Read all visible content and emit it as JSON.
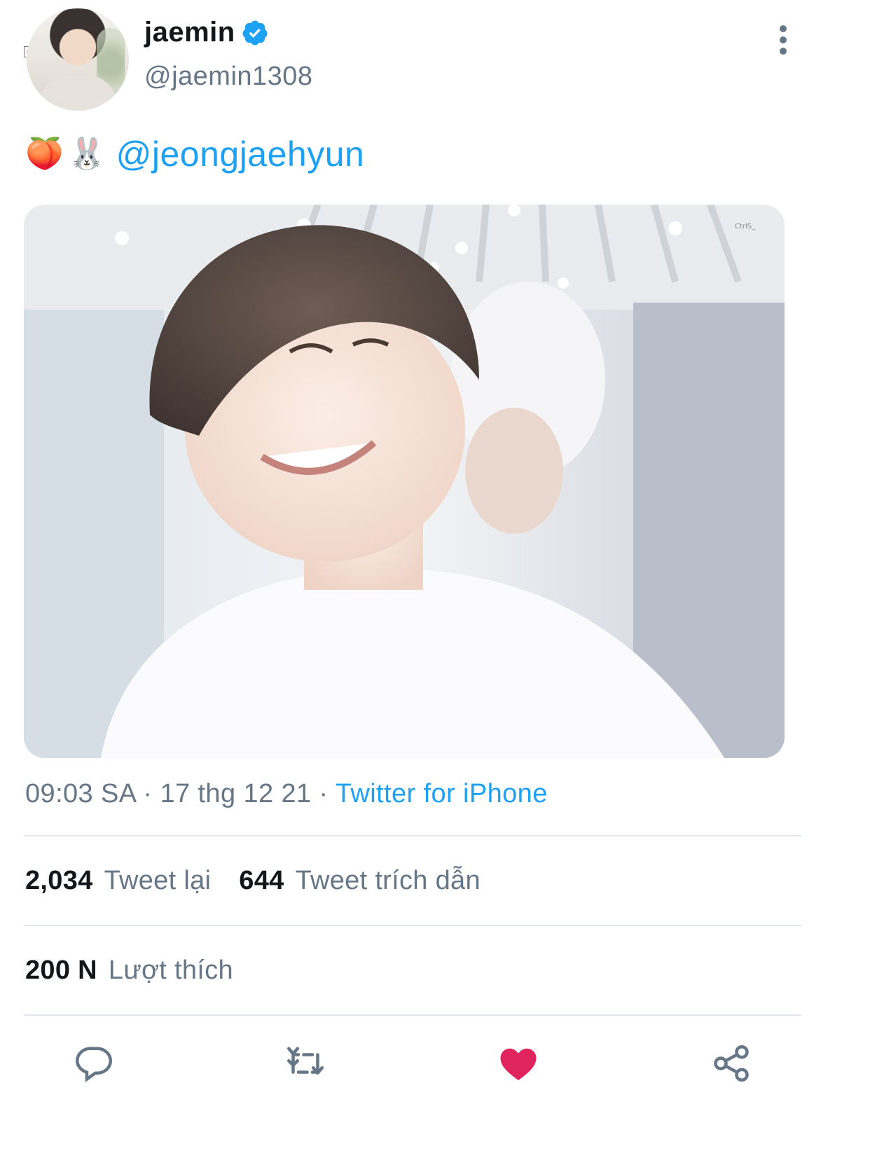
{
  "user": {
    "display_name": "jaemin",
    "handle": "@jaemin1308",
    "verified": true
  },
  "tweet": {
    "emojis": [
      "🍑",
      "🐰"
    ],
    "mention": "@jeongjaehyun",
    "watermark": "CtrlS_"
  },
  "meta": {
    "time": "09:03 SA",
    "separator": " · ",
    "date": "17 thg 12 21",
    "source": "Twitter for iPhone"
  },
  "stats": {
    "retweets": {
      "value": "2,034",
      "label": "Tweet lại"
    },
    "quotes": {
      "value": "644",
      "label": "Tweet trích dẫn"
    },
    "likes": {
      "value": "200 N",
      "label": "Lượt thích"
    }
  },
  "actions": {
    "reply_icon": "reply-icon",
    "retweet_icon": "retweet-icon",
    "like_icon": "heart-icon",
    "share_icon": "share-icon",
    "like_color": "#e0245e",
    "icon_color": "#657786"
  },
  "colors": {
    "link": "#1da1f2",
    "verified": "#1da1f2",
    "muted": "#657786",
    "text": "#14171a"
  }
}
